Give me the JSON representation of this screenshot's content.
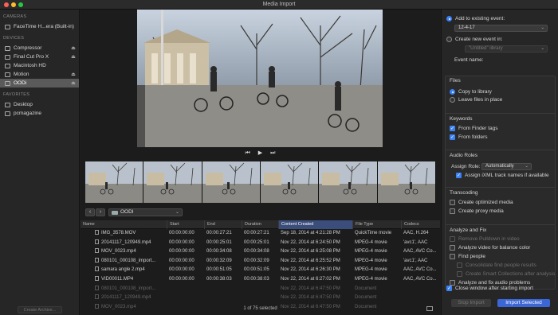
{
  "window": {
    "title": "Media Import"
  },
  "sidebar": {
    "cameras_header": "CAMERAS",
    "cameras": [
      {
        "label": "FaceTime H...era (Built-in)"
      }
    ],
    "devices_header": "DEVICES",
    "devices": [
      {
        "label": "Compressor",
        "eject": "⏏"
      },
      {
        "label": "Final Cut Pro X",
        "eject": "⏏"
      },
      {
        "label": "Macintosh HD",
        "eject": ""
      },
      {
        "label": "Motion",
        "eject": "⏏"
      },
      {
        "label": "OODi",
        "eject": "⏏",
        "selected": true
      }
    ],
    "favorites_header": "FAVORITES",
    "favorites": [
      {
        "label": "Desktop"
      },
      {
        "label": "pcmagazine"
      }
    ],
    "create_archive": "Create Archive..."
  },
  "transport": {
    "prev": "⏮",
    "play": "▶",
    "next": "⏭"
  },
  "browser": {
    "back": "‹",
    "forward": "›",
    "folder": "OODI",
    "columns": [
      "Name",
      "Start",
      "End",
      "Duration",
      "Content Created",
      "File Type",
      "Codecs"
    ],
    "sort_column": "Content Created",
    "rows": [
      {
        "name": "IMG_3578.MOV",
        "start": "00:00:00:00",
        "end": "00:00:27:21",
        "duration": "00:00:27:21",
        "created": "Sep 18, 2014 at 4:21:28 PM",
        "type": "QuickTime movie",
        "codecs": "AAC, H.264",
        "dim": false
      },
      {
        "name": "20141117_120949.mp4",
        "start": "00:00:00:00",
        "end": "00:00:25:01",
        "duration": "00:00:25:01",
        "created": "Nov 22, 2014 at 6:24:50 PM",
        "type": "MPEG-4 movie",
        "codecs": "'avc1', AAC",
        "dim": false
      },
      {
        "name": "MOV_0023.mp4",
        "start": "00:00:00:00",
        "end": "00:00:34:08",
        "duration": "00:00:34:08",
        "created": "Nov 22, 2014 at 6:25:08 PM",
        "type": "MPEG-4 movie",
        "codecs": "AAC, AVC Co...",
        "dim": false
      },
      {
        "name": "080101_000108_import...",
        "start": "00:00:00:00",
        "end": "00:00:32:09",
        "duration": "00:00:32:09",
        "created": "Nov 22, 2014 at 6:25:52 PM",
        "type": "MPEG-4 movie",
        "codecs": "'avc1', AAC",
        "dim": false
      },
      {
        "name": "samara angle 2.mp4",
        "start": "00:00:00:00",
        "end": "00:00:51:05",
        "duration": "00:00:51:05",
        "created": "Nov 22, 2014 at 6:26:30 PM",
        "type": "MPEG-4 movie",
        "codecs": "AAC, AVC Co...",
        "dim": false
      },
      {
        "name": "VID00011.MP4",
        "start": "00:00:00:00",
        "end": "00:00:38:03",
        "duration": "00:00:38:03",
        "created": "Nov 22, 2014 at 6:27:02 PM",
        "type": "MPEG-4 movie",
        "codecs": "AAC, AVC Co...",
        "dim": false
      },
      {
        "name": "080101_000108_import...",
        "start": "",
        "end": "",
        "duration": "",
        "created": "Nov 22, 2014 at 6:47:50 PM",
        "type": "Document",
        "codecs": "",
        "dim": true
      },
      {
        "name": "20141117_120949.mp4",
        "start": "",
        "end": "",
        "duration": "",
        "created": "Nov 22, 2014 at 6:47:50 PM",
        "type": "Document",
        "codecs": "",
        "dim": true
      },
      {
        "name": "MOV_0023.mp4",
        "start": "",
        "end": "",
        "duration": "",
        "created": "Nov 22, 2014 at 6:47:50 PM",
        "type": "Document",
        "codecs": "",
        "dim": true
      }
    ],
    "status": "1 of 75 selected"
  },
  "panel": {
    "add_existing": "Add to existing event:",
    "existing_event": "12-4-17",
    "create_new": "Create new event in:",
    "new_event_placeholder": "\"Untitled\" library",
    "event_name_label": "Event name:",
    "files_title": "Files",
    "copy_to_library": "Copy to library",
    "leave_in_place": "Leave files in place",
    "keywords_title": "Keywords",
    "from_finder_tags": "From Finder tags",
    "from_folders": "From folders",
    "audio_roles_title": "Audio Roles",
    "assign_role_label": "Assign Role:",
    "assign_role_value": "Automatically",
    "assign_ixml": "Assign iXML track names if available",
    "transcoding_title": "Transcoding",
    "optimized_media": "Create optimized media",
    "proxy_media": "Create proxy media",
    "analyze_title": "Analyze and Fix",
    "remove_pulldown": "Remove Pulldown in video",
    "analyze_balance": "Analyze video for balance color",
    "find_people": "Find people",
    "consolidate_results": "Consolidate find people results",
    "smart_collections": "Create Smart Collections after analysis",
    "analyze_audio": "Analyze and fix audio problems",
    "close_window": "Close window after starting import",
    "stop_import": "Stop Import",
    "import_selected": "Import Selected"
  }
}
